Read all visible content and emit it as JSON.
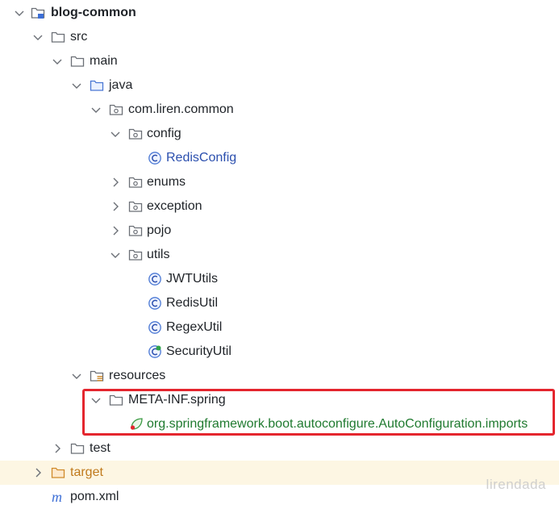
{
  "tree": {
    "project": "blog-common",
    "src": "src",
    "main": "main",
    "java": "java",
    "package": "com.liren.common",
    "config": "config",
    "redis_config": "RedisConfig",
    "enums": "enums",
    "exception": "exception",
    "pojo": "pojo",
    "utils": "utils",
    "jwt_utils": "JWTUtils",
    "redis_util": "RedisUtil",
    "regex_util": "RegexUtil",
    "security_util": "SecurityUtil",
    "resources": "resources",
    "meta_inf": "META-INF.spring",
    "imports_file": "org.springframework.boot.autoconfigure.AutoConfiguration.imports",
    "test": "test",
    "target": "target",
    "pom": "pom.xml"
  },
  "watermark": "lirendada",
  "colors": {
    "class_blue": "#2b4fae",
    "spring_green": "#1f7a2f",
    "target_orange": "#c07a1c",
    "highlight_border": "#e4262e",
    "target_row_bg": "#fdf6e3"
  },
  "icons": {
    "module": "module-folder-icon",
    "folder": "folder-icon",
    "source_root": "source-root-folder-icon",
    "package": "package-icon",
    "class": "class-icon",
    "resources": "resources-folder-icon",
    "spring_file": "spring-leaf-icon",
    "excluded": "excluded-folder-icon",
    "maven": "maven-icon"
  }
}
